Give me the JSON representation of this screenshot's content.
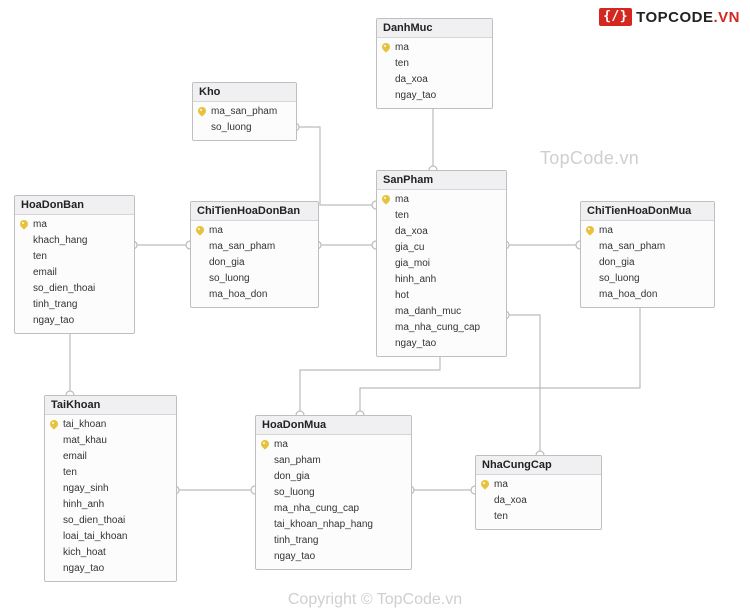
{
  "brand": {
    "mark": "{/}",
    "name1": "TOPCODE",
    "name2": ".VN"
  },
  "watermarks": {
    "top": "TopCode.vn",
    "bottom": "Copyright © TopCode.vn"
  },
  "entities": {
    "DanhMuc": {
      "title": "DanhMuc",
      "fields": [
        "ma",
        "ten",
        "da_xoa",
        "ngay_tao"
      ],
      "keys": [
        "ma"
      ]
    },
    "Kho": {
      "title": "Kho",
      "fields": [
        "ma_san_pham",
        "so_luong"
      ],
      "keys": [
        "ma_san_pham"
      ]
    },
    "SanPham": {
      "title": "SanPham",
      "fields": [
        "ma",
        "ten",
        "da_xoa",
        "gia_cu",
        "gia_moi",
        "hinh_anh",
        "hot",
        "ma_danh_muc",
        "ma_nha_cung_cap",
        "ngay_tao"
      ],
      "keys": [
        "ma"
      ]
    },
    "HoaDonBan": {
      "title": "HoaDonBan",
      "fields": [
        "ma",
        "khach_hang",
        "ten",
        "email",
        "so_dien_thoai",
        "tinh_trang",
        "ngay_tao"
      ],
      "keys": [
        "ma"
      ]
    },
    "ChiTienHoaDonBan": {
      "title": "ChiTienHoaDonBan",
      "fields": [
        "ma",
        "ma_san_pham",
        "don_gia",
        "so_luong",
        "ma_hoa_don"
      ],
      "keys": [
        "ma"
      ]
    },
    "ChiTienHoaDonMua": {
      "title": "ChiTienHoaDonMua",
      "fields": [
        "ma",
        "ma_san_pham",
        "don_gia",
        "so_luong",
        "ma_hoa_don"
      ],
      "keys": [
        "ma"
      ]
    },
    "TaiKhoan": {
      "title": "TaiKhoan",
      "fields": [
        "tai_khoan",
        "mat_khau",
        "email",
        "ten",
        "ngay_sinh",
        "hinh_anh",
        "so_dien_thoai",
        "loai_tai_khoan",
        "kich_hoat",
        "ngay_tao"
      ],
      "keys": [
        "tai_khoan"
      ]
    },
    "HoaDonMua": {
      "title": "HoaDonMua",
      "fields": [
        "ma",
        "san_pham",
        "don_gia",
        "so_luong",
        "ma_nha_cung_cap",
        "tai_khoan_nhap_hang",
        "tinh_trang",
        "ngay_tao"
      ],
      "keys": [
        "ma"
      ]
    },
    "NhaCungCap": {
      "title": "NhaCungCap",
      "fields": [
        "ma",
        "da_xoa",
        "ten"
      ],
      "keys": [
        "ma"
      ]
    }
  },
  "chart_data": {
    "type": "table",
    "title": "Database schema (ER diagram)",
    "tables": [
      {
        "name": "DanhMuc",
        "primary_key": [
          "ma"
        ],
        "columns": [
          "ma",
          "ten",
          "da_xoa",
          "ngay_tao"
        ]
      },
      {
        "name": "Kho",
        "primary_key": [
          "ma_san_pham"
        ],
        "columns": [
          "ma_san_pham",
          "so_luong"
        ]
      },
      {
        "name": "SanPham",
        "primary_key": [
          "ma"
        ],
        "columns": [
          "ma",
          "ten",
          "da_xoa",
          "gia_cu",
          "gia_moi",
          "hinh_anh",
          "hot",
          "ma_danh_muc",
          "ma_nha_cung_cap",
          "ngay_tao"
        ]
      },
      {
        "name": "HoaDonBan",
        "primary_key": [
          "ma"
        ],
        "columns": [
          "ma",
          "khach_hang",
          "ten",
          "email",
          "so_dien_thoai",
          "tinh_trang",
          "ngay_tao"
        ]
      },
      {
        "name": "ChiTienHoaDonBan",
        "primary_key": [
          "ma"
        ],
        "columns": [
          "ma",
          "ma_san_pham",
          "don_gia",
          "so_luong",
          "ma_hoa_don"
        ]
      },
      {
        "name": "ChiTienHoaDonMua",
        "primary_key": [
          "ma"
        ],
        "columns": [
          "ma",
          "ma_san_pham",
          "don_gia",
          "so_luong",
          "ma_hoa_don"
        ]
      },
      {
        "name": "TaiKhoan",
        "primary_key": [
          "tai_khoan"
        ],
        "columns": [
          "tai_khoan",
          "mat_khau",
          "email",
          "ten",
          "ngay_sinh",
          "hinh_anh",
          "so_dien_thoai",
          "loai_tai_khoan",
          "kich_hoat",
          "ngay_tao"
        ]
      },
      {
        "name": "HoaDonMua",
        "primary_key": [
          "ma"
        ],
        "columns": [
          "ma",
          "san_pham",
          "don_gia",
          "so_luong",
          "ma_nha_cung_cap",
          "tai_khoan_nhap_hang",
          "tinh_trang",
          "ngay_tao"
        ]
      },
      {
        "name": "NhaCungCap",
        "primary_key": [
          "ma"
        ],
        "columns": [
          "ma",
          "da_xoa",
          "ten"
        ]
      }
    ],
    "relationships": [
      {
        "from": "Kho.ma_san_pham",
        "to": "SanPham.ma"
      },
      {
        "from": "SanPham.ma_danh_muc",
        "to": "DanhMuc.ma"
      },
      {
        "from": "ChiTienHoaDonBan.ma_san_pham",
        "to": "SanPham.ma"
      },
      {
        "from": "ChiTienHoaDonBan.ma_hoa_don",
        "to": "HoaDonBan.ma"
      },
      {
        "from": "ChiTienHoaDonMua.ma_san_pham",
        "to": "SanPham.ma"
      },
      {
        "from": "ChiTienHoaDonMua.ma_hoa_don",
        "to": "HoaDonMua.ma"
      },
      {
        "from": "HoaDonBan.khach_hang",
        "to": "TaiKhoan.tai_khoan"
      },
      {
        "from": "HoaDonMua.tai_khoan_nhap_hang",
        "to": "TaiKhoan.tai_khoan"
      },
      {
        "from": "HoaDonMua.ma_nha_cung_cap",
        "to": "NhaCungCap.ma"
      },
      {
        "from": "SanPham.ma_nha_cung_cap",
        "to": "NhaCungCap.ma"
      }
    ]
  }
}
